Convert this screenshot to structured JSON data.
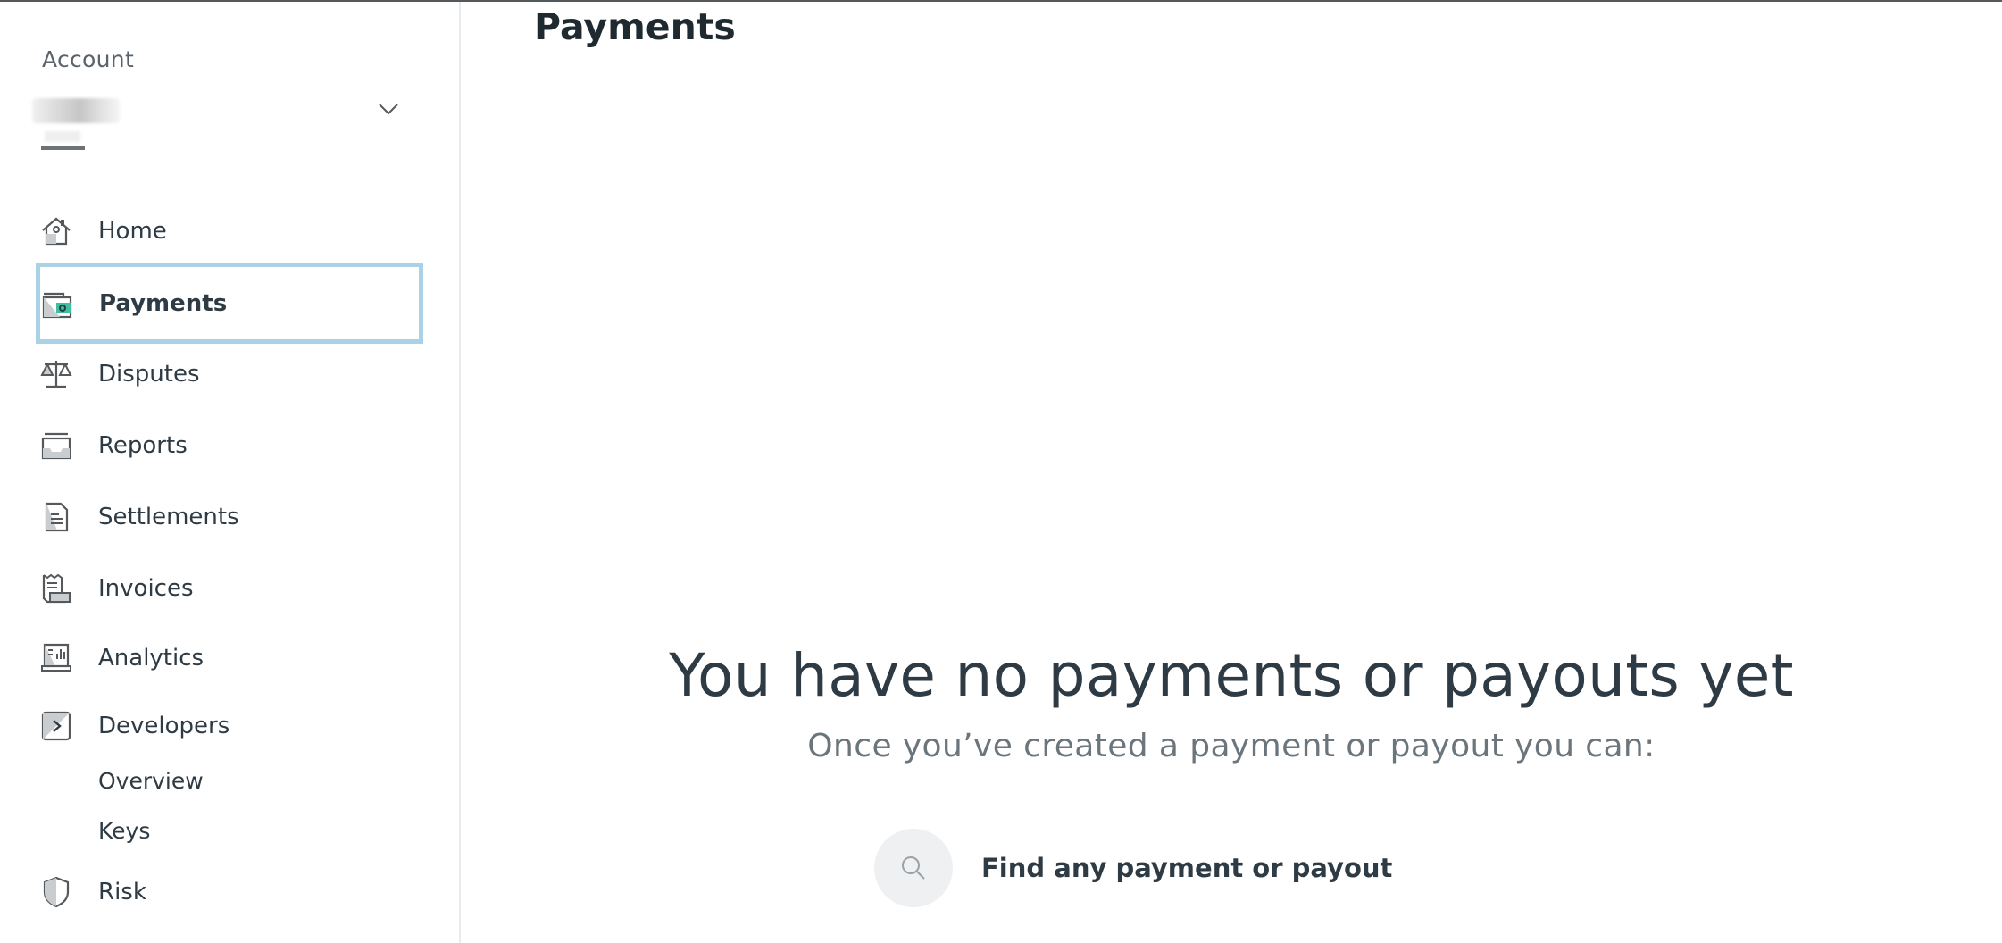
{
  "page": {
    "title": "Payments"
  },
  "sidebar": {
    "account_label": "Account",
    "items": [
      {
        "label": "Home",
        "icon": "home-icon"
      },
      {
        "label": "Payments",
        "icon": "wallet-icon",
        "active": true
      },
      {
        "label": "Disputes",
        "icon": "scales-icon"
      },
      {
        "label": "Reports",
        "icon": "tray-icon"
      },
      {
        "label": "Settlements",
        "icon": "document-icon"
      },
      {
        "label": "Invoices",
        "icon": "receipt-icon"
      },
      {
        "label": "Analytics",
        "icon": "analytics-icon"
      },
      {
        "label": "Developers",
        "icon": "terminal-icon"
      },
      {
        "label": "Risk",
        "icon": "shield-icon"
      }
    ],
    "developers_sub": [
      {
        "label": "Overview"
      },
      {
        "label": "Keys"
      }
    ]
  },
  "empty_state": {
    "title": "You have no payments or payouts yet",
    "subtitle": "Once you’ve created a payment or payout you can:",
    "features": [
      {
        "label": "Find any payment or payout",
        "icon": "search-icon"
      }
    ]
  },
  "colors": {
    "accent_border": "#a9d2e6",
    "text": "#2e3b44",
    "muted": "#6b757c",
    "icon_teal": "#3fbf9f"
  }
}
